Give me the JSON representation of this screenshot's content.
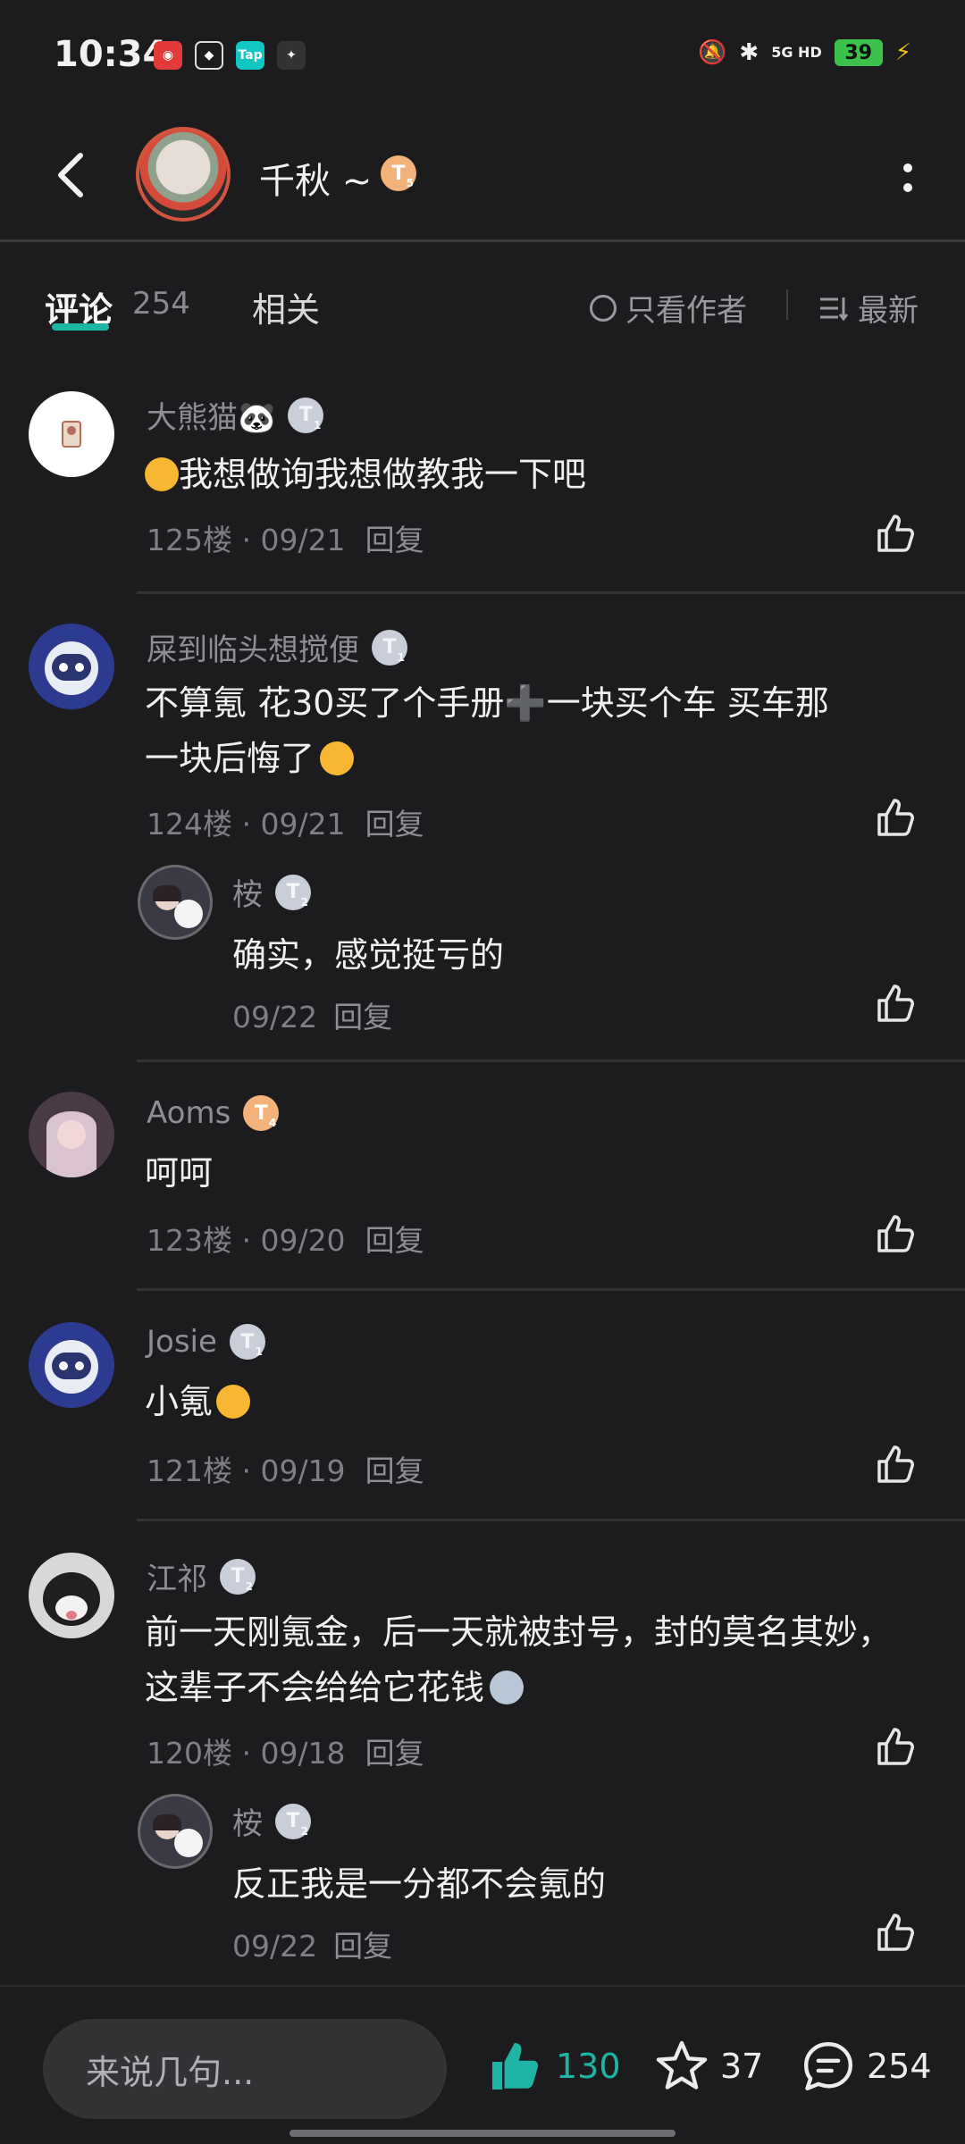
{
  "status": {
    "time": "10:34",
    "apps": [
      "netease-music-icon",
      "app-diamond-icon",
      "taptap-icon",
      "game-icon"
    ],
    "taptap_label": "Tap",
    "network": "5G HD",
    "battery": "39",
    "battery_color": "#3cc14d"
  },
  "header": {
    "author_name": "千秋 ~",
    "author_badge": "T",
    "author_level": "5"
  },
  "tabs": {
    "comments_label": "评论",
    "comments_count": "254",
    "related_label": "相关",
    "only_author_label": "只看作者",
    "sort_label": "最新"
  },
  "comments": [
    {
      "user": "大熊猫🐼",
      "badge": "T",
      "level": "1",
      "text": "我想做询我想做教我一下吧",
      "floor": "125楼 · 09/21",
      "reply_label": "回复"
    },
    {
      "user": "屎到临头想搅便",
      "badge": "T",
      "level": "1",
      "text_line1": "不算氪 花30买了个手册➕一块买个车 买车那",
      "text_line2": "一块后悔了",
      "floor": "124楼 · 09/21",
      "reply_label": "回复",
      "reply": {
        "user": "桉",
        "badge": "T",
        "level": "2",
        "text": "确实，感觉挺亏的",
        "date": "09/22",
        "reply_label": "回复"
      }
    },
    {
      "user": "Aoms",
      "badge": "T",
      "level": "4",
      "text": "呵呵",
      "floor": "123楼 · 09/20",
      "reply_label": "回复"
    },
    {
      "user": "Josie",
      "badge": "T",
      "level": "1",
      "text": "小氪",
      "floor": "121楼 · 09/19",
      "reply_label": "回复"
    },
    {
      "user": "江祁",
      "badge": "T",
      "level": "2",
      "text_line1": "前一天刚氪金，后一天就被封号，封的莫名其妙，",
      "text_line2": "这辈子不会给给它花钱",
      "floor": "120楼 · 09/18",
      "reply_label": "回复",
      "reply": {
        "user": "桉",
        "badge": "T",
        "level": "2",
        "text": "反正我是一分都不会氪的",
        "date": "09/22",
        "reply_label": "回复"
      }
    }
  ],
  "bottom": {
    "input_placeholder": "来说几句...",
    "likes": "130",
    "favorites": "37",
    "comments": "254",
    "accent": "#1fb5a6"
  }
}
